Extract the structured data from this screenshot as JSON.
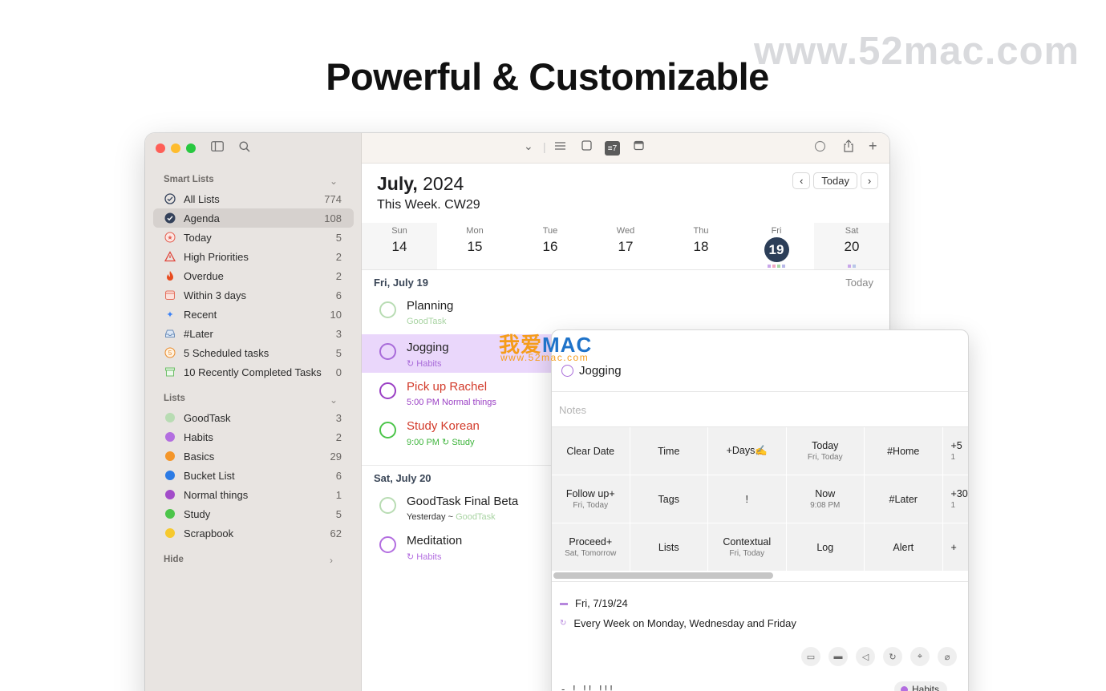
{
  "headline": "Powerful & Customizable",
  "watermark": "www.52mac.com",
  "watermark_cn": {
    "text_orange": "我爱",
    "text_blue": "MAC",
    "url": "www.52mac.com"
  },
  "colors": {
    "accent": "#2c3e58",
    "sidebar_bg": "#e8e4e1",
    "selected_row": "#ead7fb"
  },
  "sidebar": {
    "smart_title": "Smart Lists",
    "smart_items": [
      {
        "label": "All Lists",
        "count": "774",
        "icon": "checkmark-circle-icon"
      },
      {
        "label": "Agenda",
        "count": "108",
        "icon": "checkmark-circle-filled-icon",
        "selected": true
      },
      {
        "label": "Today",
        "count": "5",
        "icon": "star-circle-icon"
      },
      {
        "label": "High Priorities",
        "count": "2",
        "icon": "warning-icon"
      },
      {
        "label": "Overdue",
        "count": "2",
        "icon": "flame-icon"
      },
      {
        "label": "Within 3 days",
        "count": "6",
        "icon": "calendar-icon"
      },
      {
        "label": "Recent",
        "count": "10",
        "icon": "sparkle-icon"
      },
      {
        "label": "#Later",
        "count": "3",
        "icon": "tray-icon"
      },
      {
        "label": "5 Scheduled tasks",
        "count": "5",
        "icon": "number-circle-icon"
      },
      {
        "label": "10 Recently Completed Tasks",
        "count": "0",
        "icon": "archive-icon"
      }
    ],
    "lists_title": "Lists",
    "lists": [
      {
        "label": "GoodTask",
        "count": "3",
        "color": "#b8dcb3"
      },
      {
        "label": "Habits",
        "count": "2",
        "color": "#b36ee0"
      },
      {
        "label": "Basics",
        "count": "29",
        "color": "#f4962a"
      },
      {
        "label": "Bucket List",
        "count": "6",
        "color": "#2c7be5"
      },
      {
        "label": "Normal things",
        "count": "1",
        "color": "#a24cc9"
      },
      {
        "label": "Study",
        "count": "5",
        "color": "#4cc54a"
      },
      {
        "label": "Scrapbook",
        "count": "62",
        "color": "#f6c92e"
      }
    ],
    "hide_label": "Hide"
  },
  "header": {
    "month_bold": "July,",
    "year": "2024",
    "week": "This Week. CW29",
    "today_button": "Today"
  },
  "days": [
    {
      "name": "Sun",
      "num": "14"
    },
    {
      "name": "Mon",
      "num": "15"
    },
    {
      "name": "Tue",
      "num": "16"
    },
    {
      "name": "Wed",
      "num": "17"
    },
    {
      "name": "Thu",
      "num": "18"
    },
    {
      "name": "Fri",
      "num": "19"
    },
    {
      "name": "Sat",
      "num": "20"
    }
  ],
  "groups": [
    {
      "title": "Fri, July 19",
      "right": "Today"
    },
    {
      "title": "Sat, July 20"
    }
  ],
  "tasks": [
    {
      "title": "Planning",
      "sub": "GoodTask",
      "sub2": ""
    },
    {
      "title": "Jogging",
      "sub": "Habits",
      "sub2": ""
    },
    {
      "title": "Pick up Rachel",
      "sub": "5:00 PM",
      "sub2": "Normal things"
    },
    {
      "title": "Study Korean",
      "sub": "9:00 PM",
      "sub2": "Study"
    },
    {
      "title": "GoodTask Final Beta",
      "sub": "Yesterday ~",
      "sub2": "GoodTask"
    },
    {
      "title": "Meditation",
      "sub": "Habits",
      "sub2": ""
    }
  ],
  "popup": {
    "title": "Jogging",
    "notes_placeholder": "Notes",
    "cells": [
      {
        "m": "Clear Date",
        "s": ""
      },
      {
        "m": "Time",
        "s": ""
      },
      {
        "m": "+Days✍️",
        "s": ""
      },
      {
        "m": "Today",
        "s": "Fri, Today"
      },
      {
        "m": "#Home",
        "s": ""
      },
      {
        "m": "+5",
        "s": "1"
      },
      {
        "m": "Follow up+",
        "s": "Fri, Today"
      },
      {
        "m": "Tags",
        "s": ""
      },
      {
        "m": "!",
        "s": ""
      },
      {
        "m": "Now",
        "s": "9:08 PM"
      },
      {
        "m": "#Later",
        "s": ""
      },
      {
        "m": "+30",
        "s": "1"
      },
      {
        "m": "Proceed+",
        "s": "Sat, Tomorrow"
      },
      {
        "m": "Lists",
        "s": ""
      },
      {
        "m": "Contextual",
        "s": "Fri, Today"
      },
      {
        "m": "Log",
        "s": ""
      },
      {
        "m": "Alert",
        "s": ""
      },
      {
        "m": "+",
        "s": ""
      }
    ],
    "date": "Fri, 7/19/24",
    "repeat": "Every Week on Monday, Wednesday and Friday",
    "bottom_text": "- ! !! !!!",
    "list_pill": "Habits"
  }
}
